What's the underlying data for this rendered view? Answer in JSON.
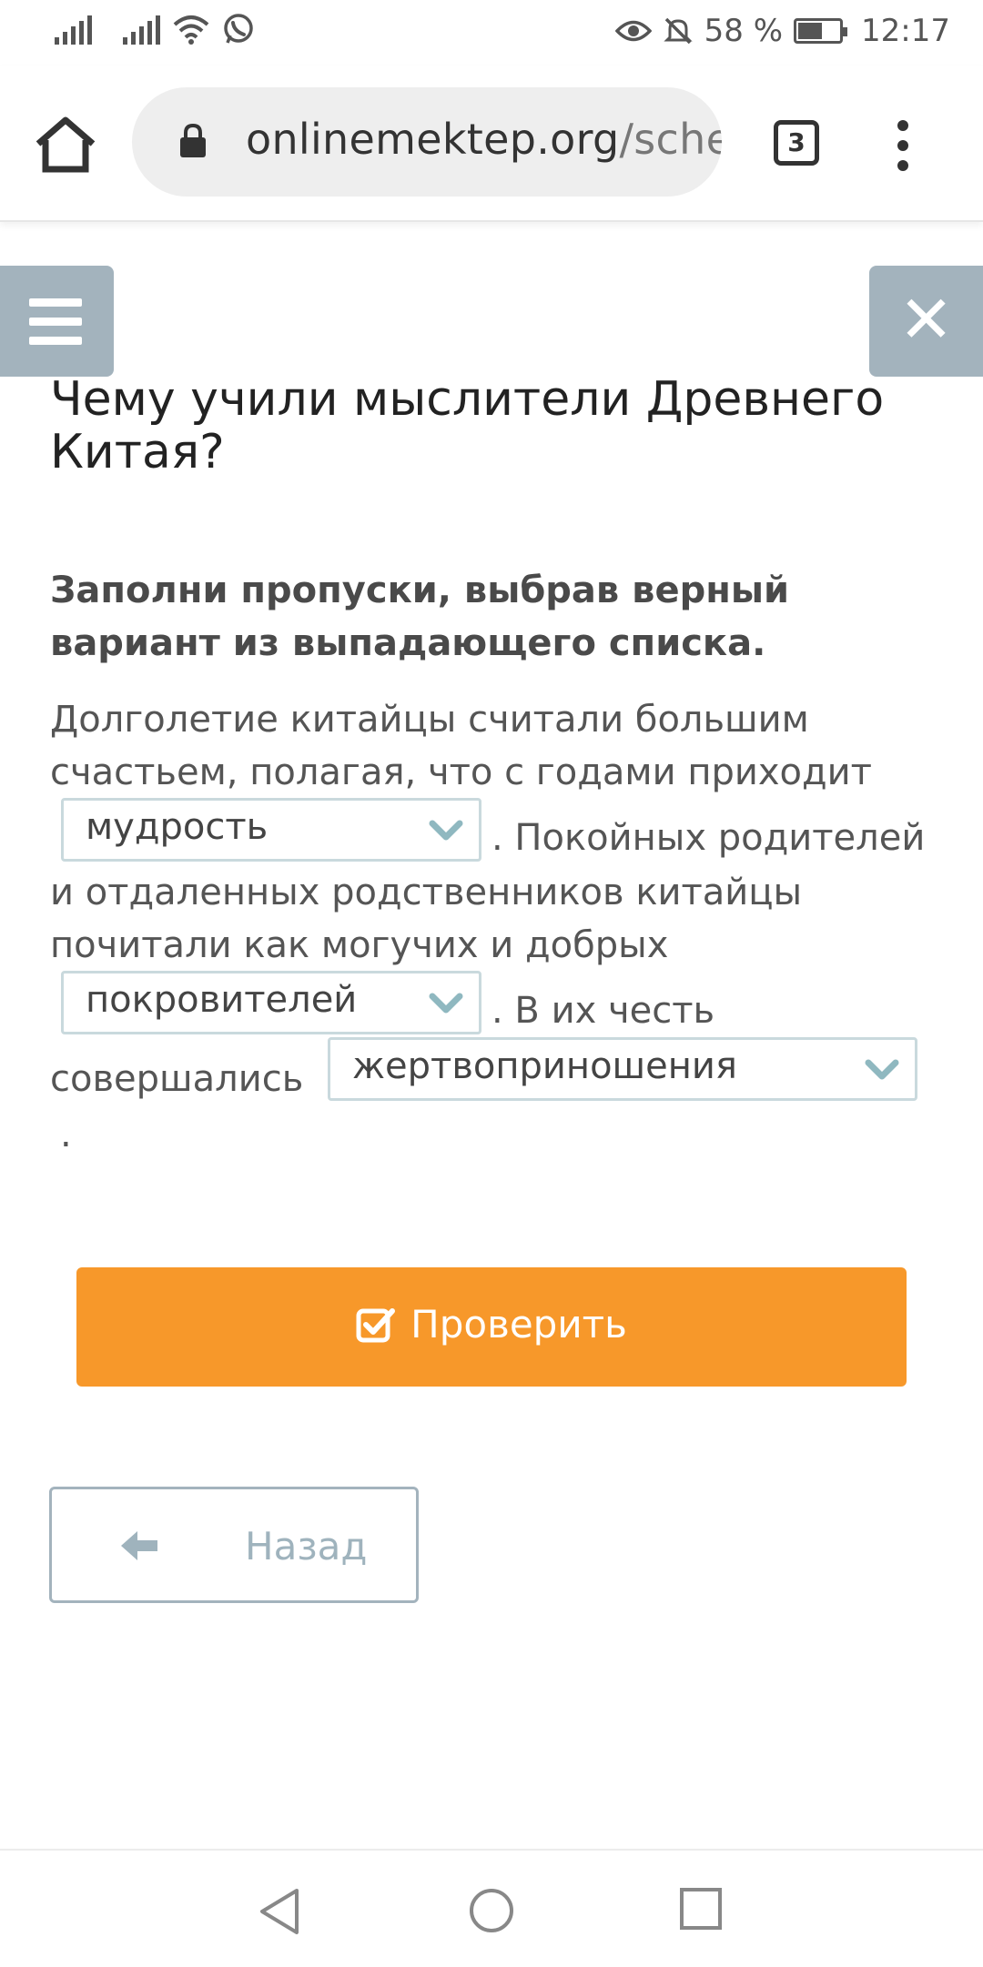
{
  "status_bar": {
    "battery": "58 %",
    "battery_level": 0.58,
    "time": "12:17"
  },
  "browser": {
    "url_main": "onlinemektep.org",
    "url_rest": "/sche",
    "tab_count": "3"
  },
  "page": {
    "title": "Чему учили мыслители Древнего Китая?",
    "instruction": "Заполни пропуски, выбрав верный вариант из выпадающего списка.",
    "text_line_1": "Долголетие китайцы считали большим",
    "text_line_2": "счастьем, полагая, что с годами приходит",
    "text_after_1": ". Покойных родителей",
    "text_line_4": "и отдаленных родственников китайцы",
    "text_line_5": "почитали как могучих и добрых",
    "text_after_2": ". В их честь",
    "text_before_3": "совершались",
    "text_end": ".",
    "dropdown_1_value": "мудрость",
    "dropdown_2_value": "покровителей",
    "dropdown_3_value": "жертвоприношения",
    "check_button": "Проверить",
    "back_button": "Назад"
  },
  "colors": {
    "accent_orange": "#f7982a",
    "side_button_gray": "#a3b3bd",
    "dropdown_border": "#c9d9dd",
    "chevron": "#8fb8c0"
  },
  "icons": [
    "home-icon",
    "lock-icon",
    "tabs-icon",
    "more-vert-icon",
    "menu-icon",
    "close-icon",
    "chevron-down-icon",
    "checkbox-icon",
    "arrow-left-icon",
    "nav-back-icon",
    "nav-home-icon",
    "nav-recent-icon"
  ]
}
